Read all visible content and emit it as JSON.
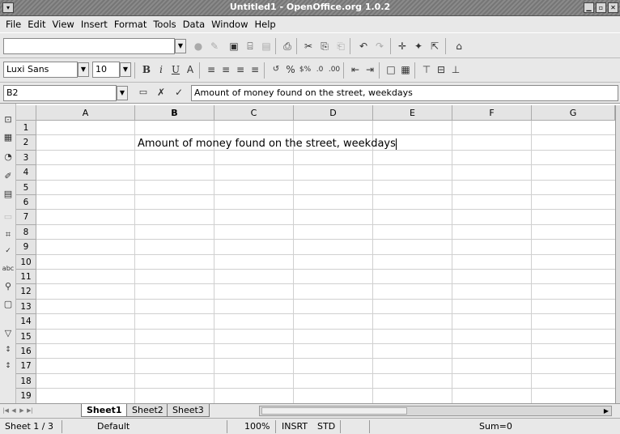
{
  "window": {
    "title": "Untitled1 - OpenOffice.org 1.0.2"
  },
  "menu": [
    "File",
    "Edit",
    "View",
    "Insert",
    "Format",
    "Tools",
    "Data",
    "Window",
    "Help"
  ],
  "toolbar": {
    "url_value": ""
  },
  "formatting": {
    "font_name": "Luxi Sans",
    "font_size": "10",
    "bold": "B",
    "italic": "i",
    "underline": "U"
  },
  "formula_bar": {
    "cell_ref": "B2",
    "content": "Amount of money found on the street, weekdays"
  },
  "grid": {
    "columns": [
      "A",
      "B",
      "C",
      "D",
      "E",
      "F",
      "G"
    ],
    "rows": [
      "1",
      "2",
      "3",
      "4",
      "5",
      "6",
      "7",
      "8",
      "9",
      "10",
      "11",
      "12",
      "13",
      "14",
      "15",
      "16",
      "17",
      "18",
      "19"
    ],
    "b2_text": "Amount of money found on the street, weekdays"
  },
  "sheets": [
    "Sheet1",
    "Sheet2",
    "Sheet3"
  ],
  "active_sheet": "Sheet1",
  "status": {
    "sheet": "Sheet 1 / 3",
    "style": "Default",
    "zoom": "100%",
    "mode": "INSRT",
    "sel": "STD",
    "sum": "Sum=0"
  }
}
